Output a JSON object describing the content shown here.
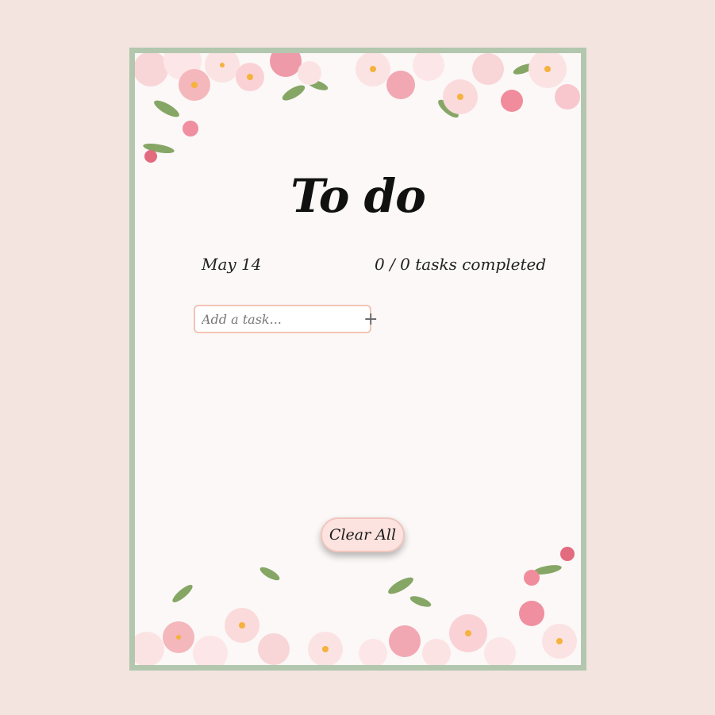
{
  "app": {
    "title": "To do",
    "date": "May 14",
    "progress_text": "0 / 0 tasks completed"
  },
  "add_task": {
    "placeholder": "Add a task...",
    "value": "",
    "button_icon": "plus-icon",
    "button_label": "+"
  },
  "actions": {
    "clear_all_label": "Clear All"
  },
  "colors": {
    "page_background": "#f3e4e0",
    "card_background": "#fbf8f7",
    "card_border": "#b3c7ae",
    "input_border": "#f2c4b6",
    "clear_button_background": "#fde3df"
  },
  "decorations": [
    "floral-border-top",
    "floral-border-bottom"
  ]
}
